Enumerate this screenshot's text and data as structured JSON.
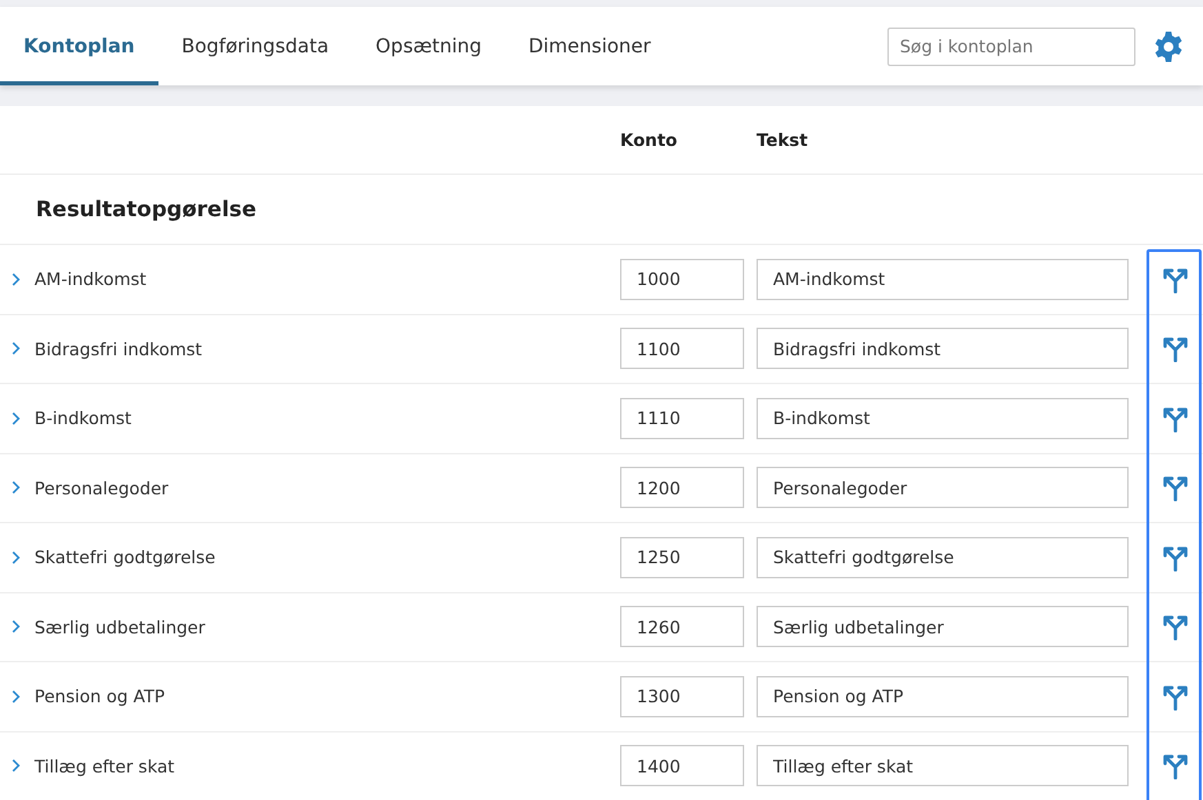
{
  "tabs": [
    {
      "label": "Kontoplan",
      "selected": true
    },
    {
      "label": "Bogføringsdata",
      "selected": false
    },
    {
      "label": "Opsætning",
      "selected": false
    },
    {
      "label": "Dimensioner",
      "selected": false
    }
  ],
  "search": {
    "placeholder": "Søg i kontoplan"
  },
  "table": {
    "columns": [
      "Konto",
      "Tekst"
    ],
    "section": "Resultatopgørelse",
    "rows": [
      {
        "name": "AM-indkomst",
        "expanded": false,
        "konto": "1000",
        "tekst": "AM-indkomst"
      },
      {
        "name": "Bidragsfri indkomst",
        "expanded": false,
        "konto": "1100",
        "tekst": "Bidragsfri indkomst"
      },
      {
        "name": "B-indkomst",
        "expanded": false,
        "konto": "1110",
        "tekst": "B-indkomst"
      },
      {
        "name": "Personalegoder",
        "expanded": false,
        "konto": "1200",
        "tekst": "Personalegoder"
      },
      {
        "name": "Skattefri godtgørelse",
        "expanded": false,
        "konto": "1250",
        "tekst": "Skattefri godtgørelse"
      },
      {
        "name": "Særlig udbetalinger",
        "expanded": false,
        "konto": "1260",
        "tekst": "Særlig udbetalinger"
      },
      {
        "name": "Pension og ATP",
        "expanded": false,
        "konto": "1300",
        "tekst": "Pension og ATP"
      },
      {
        "name": "Tillæg efter skat",
        "expanded": false,
        "konto": "1400",
        "tekst": "Tillæg efter skat"
      }
    ]
  }
}
